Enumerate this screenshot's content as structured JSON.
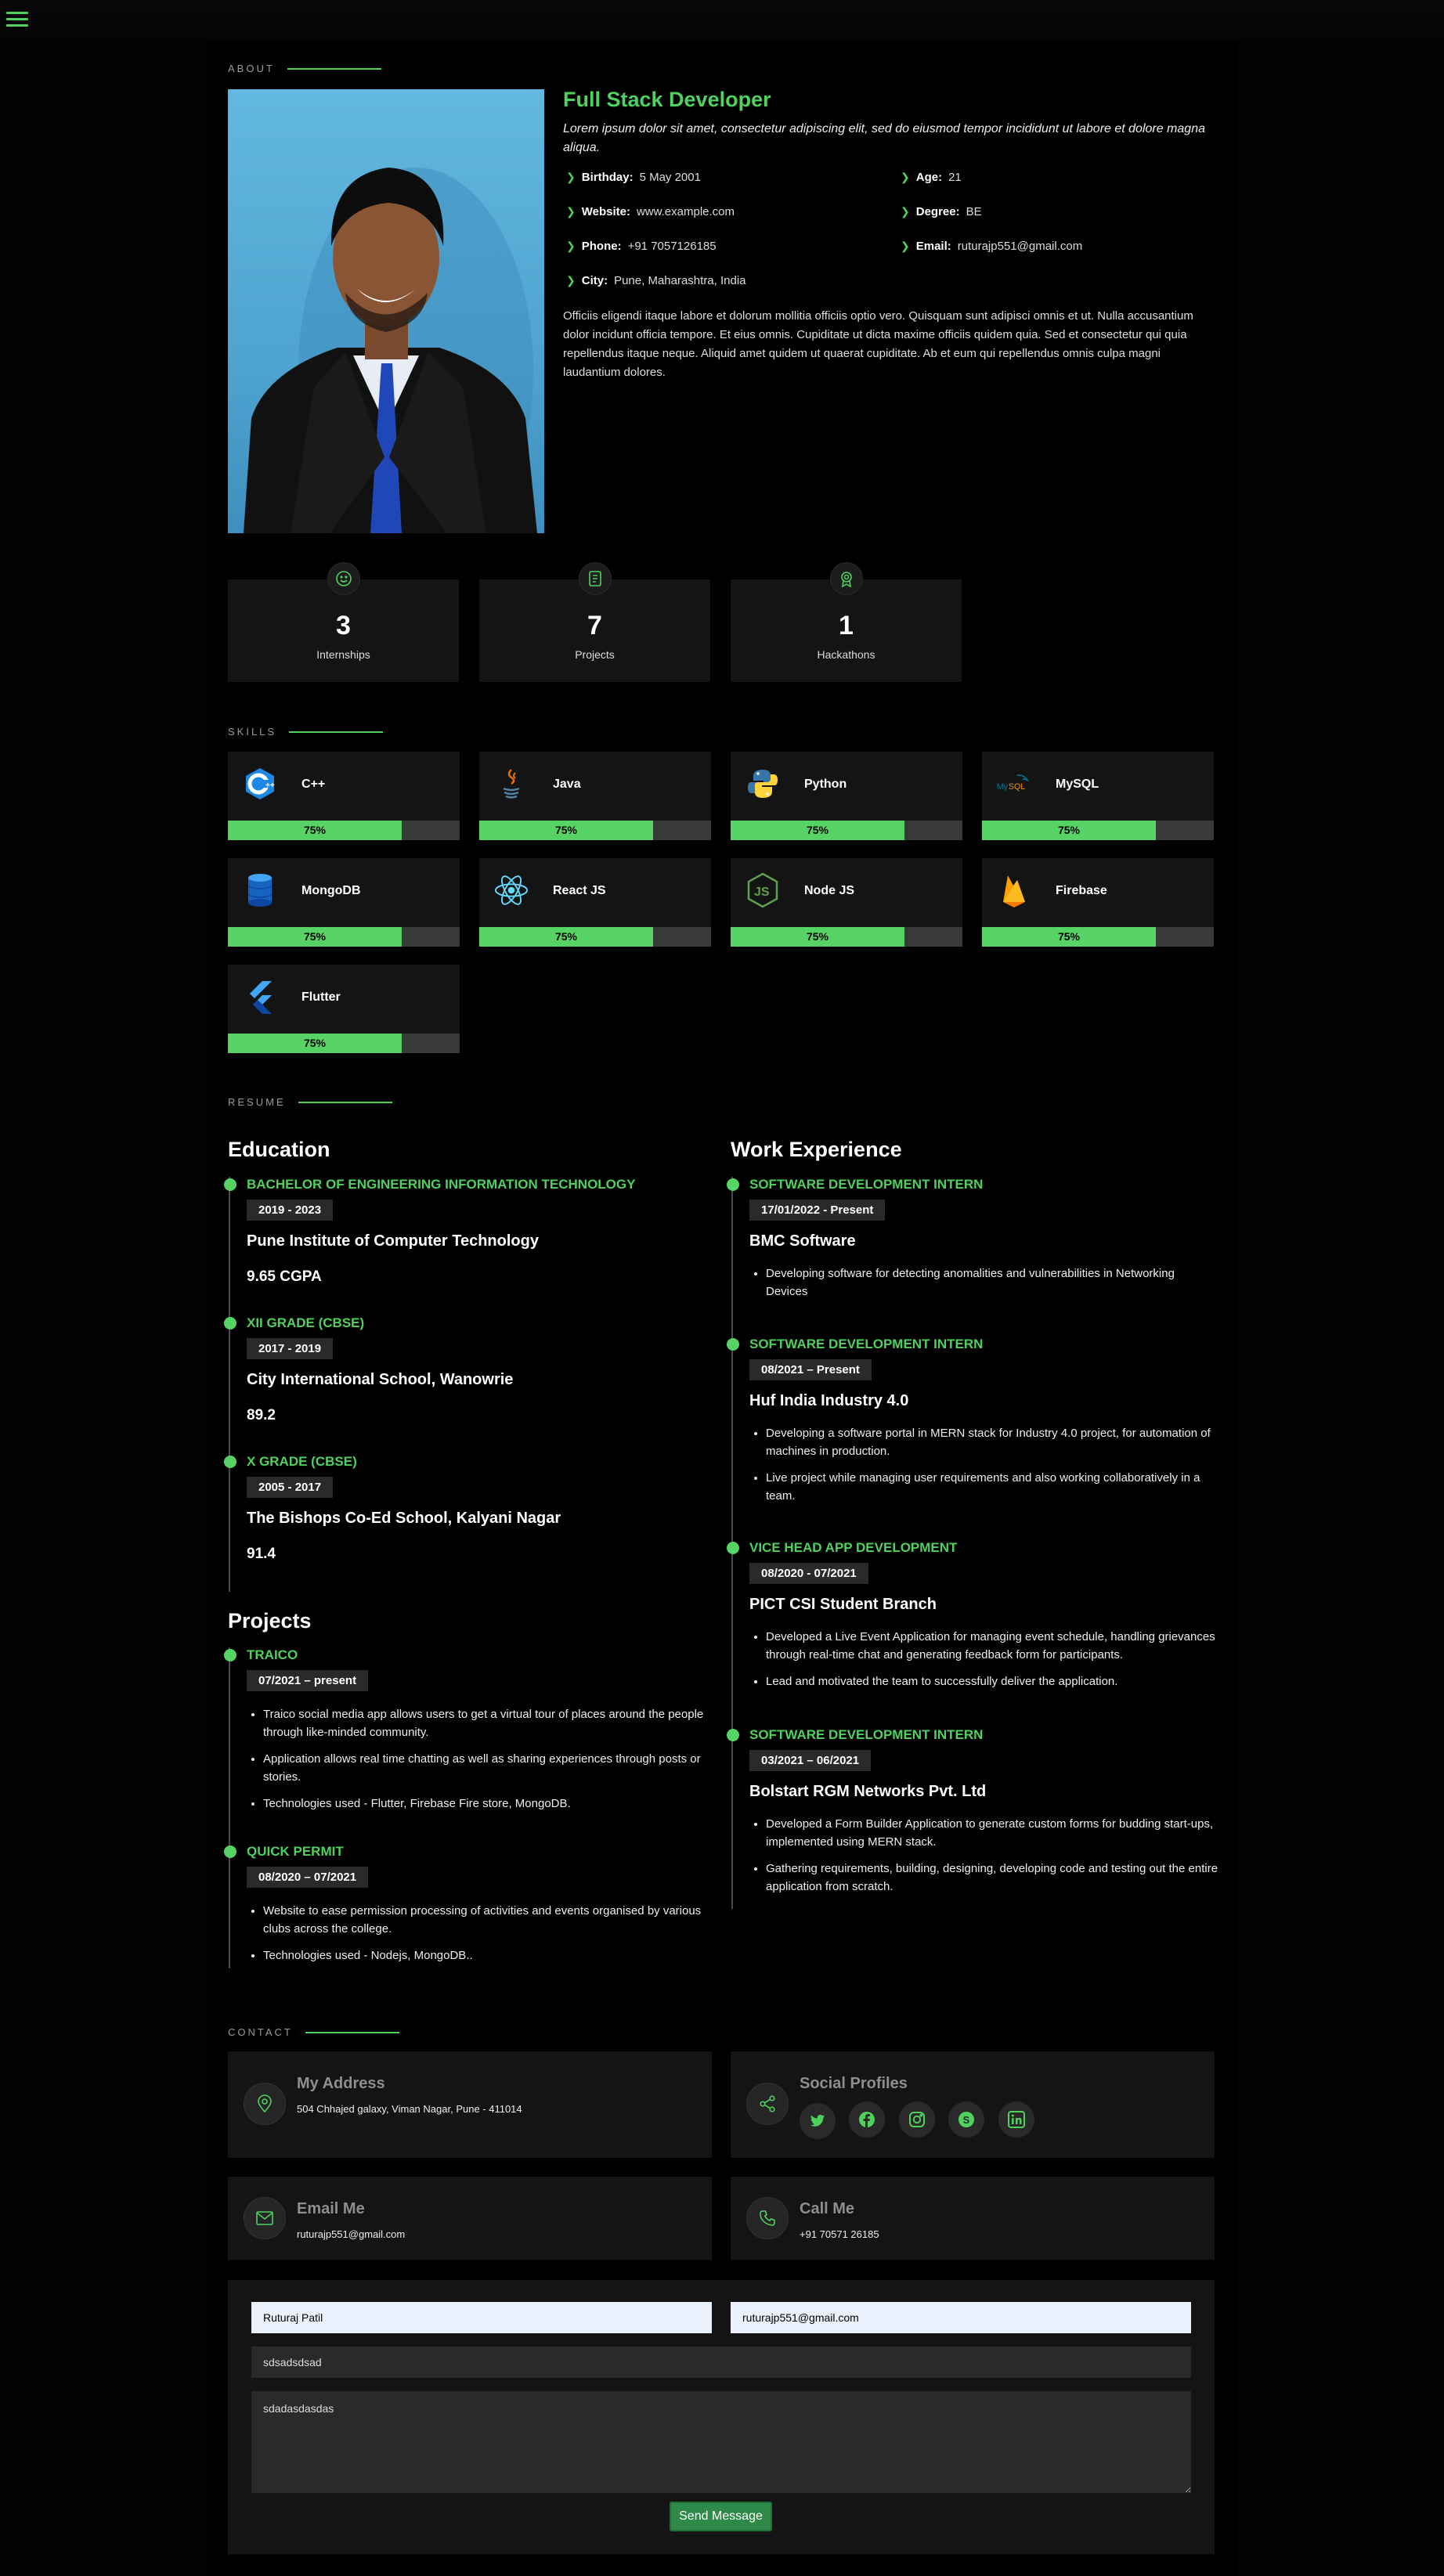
{
  "nav": {
    "menu_icon": "hamburger-icon"
  },
  "about": {
    "section_title": "About",
    "role": "Full Stack Developer",
    "lead": "Lorem ipsum dolor sit amet, consectetur adipiscing elit, sed do eiusmod tempor incididunt ut labore et dolore magna aliqua.",
    "facts": [
      {
        "label": "Birthday:",
        "value": "5 May 2001"
      },
      {
        "label": "Age:",
        "value": "21"
      },
      {
        "label": "Website:",
        "value": "www.example.com"
      },
      {
        "label": "Degree:",
        "value": "BE"
      },
      {
        "label": "Phone:",
        "value": "+91 7057126185"
      },
      {
        "label": "Email:",
        "value": "ruturajp551@gmail.com"
      },
      {
        "label": "City:",
        "value": "Pune, Maharashtra, India"
      }
    ],
    "description": "Officiis eligendi itaque labore et dolorum mollitia officiis optio vero. Quisquam sunt adipisci omnis et ut. Nulla accusantium dolor incidunt officia tempore. Et eius omnis. Cupiditate ut dicta maxime officiis quidem quia. Sed et consectetur qui quia repellendus itaque neque. Aliquid amet quidem ut quaerat cupiditate. Ab et eum qui repellendus omnis culpa magni laudantium dolores."
  },
  "counts": [
    {
      "icon": "smiley-icon",
      "value": "3",
      "label": "Internships"
    },
    {
      "icon": "document-icon",
      "value": "7",
      "label": "Projects"
    },
    {
      "icon": "award-icon",
      "value": "1",
      "label": "Hackathons"
    }
  ],
  "skills": {
    "section_title": "Skills",
    "items": [
      {
        "name": "C++",
        "level": "75%",
        "icon": "cpp-icon"
      },
      {
        "name": "Java",
        "level": "75%",
        "icon": "java-icon"
      },
      {
        "name": "Python",
        "level": "75%",
        "icon": "python-icon"
      },
      {
        "name": "MySQL",
        "level": "75%",
        "icon": "mysql-icon"
      },
      {
        "name": "MongoDB",
        "level": "75%",
        "icon": "database-icon"
      },
      {
        "name": "React JS",
        "level": "75%",
        "icon": "react-icon"
      },
      {
        "name": "Node JS",
        "level": "75%",
        "icon": "nodejs-icon"
      },
      {
        "name": "Firebase",
        "level": "75%",
        "icon": "firebase-icon"
      },
      {
        "name": "Flutter",
        "level": "75%",
        "icon": "flutter-icon"
      }
    ]
  },
  "resume": {
    "section_title": "Resume",
    "education_title": "Education",
    "education": [
      {
        "title": "Bachelor of Engineering Information Technology",
        "date": "2019 - 2023",
        "school": "Pune Institute of Computer Technology",
        "score": "9.65 CGPA"
      },
      {
        "title": "XII Grade (CBSE)",
        "date": "2017 - 2019",
        "school": "City International School, Wanowrie",
        "score": "89.2"
      },
      {
        "title": "X Grade (CBSE)",
        "date": "2005 - 2017",
        "school": "The Bishops Co-Ed School, Kalyani Nagar",
        "score": "91.4"
      }
    ],
    "projects_title": "Projects",
    "projects": [
      {
        "title": "Traico",
        "date": "07/2021 – present",
        "points": [
          "Traico social media app allows users to get a virtual tour of places around the people through like-minded community.",
          "Application allows real time chatting as well as sharing experiences through posts or stories.",
          "Technologies used - Flutter, Firebase Fire store, MongoDB."
        ]
      },
      {
        "title": "Quick Permit",
        "date": "08/2020 – 07/2021",
        "points": [
          "Website to ease permission processing of activities and events organised by various clubs across the college.",
          "Technologies used - Nodejs, MongoDB.."
        ]
      }
    ],
    "work_title": "Work Experience",
    "work": [
      {
        "title": "Software Development Intern",
        "date": "17/01/2022 - Present",
        "org": "BMC Software",
        "points": [
          "Developing software for detecting anomalities and vulnerabilities in Networking Devices"
        ]
      },
      {
        "title": "Software Development Intern",
        "date": "08/2021 – Present",
        "org": "Huf India Industry 4.0",
        "points": [
          "Developing a software portal in MERN stack for Industry 4.0 project, for automation of machines in production.",
          "Live project while managing user requirements and also working collaboratively in a team."
        ]
      },
      {
        "title": "Vice Head App Development",
        "date": "08/2020 - 07/2021",
        "org": "PICT CSI Student Branch",
        "points": [
          "Developed a Live Event Application for managing event schedule, handling grievances through real-time chat and generating feedback form for participants.",
          "Lead and motivated the team to successfully deliver the application."
        ]
      },
      {
        "title": "Software Development Intern",
        "date": "03/2021 – 06/2021",
        "org": "Bolstart RGM Networks Pvt. Ltd",
        "points": [
          "Developed a Form Builder Application to generate custom forms for budding start-ups, implemented using MERN stack.",
          "Gathering requirements, building, designing, developing code and testing out the entire application from scratch."
        ]
      }
    ]
  },
  "contact": {
    "section_title": "Contact",
    "address_title": "My Address",
    "address": "504 Chhajed galaxy, Viman Nagar, Pune - 411014",
    "social_title": "Social Profiles",
    "social_icons": [
      "twitter-icon",
      "facebook-icon",
      "instagram-icon",
      "skype-icon",
      "linkedin-icon"
    ],
    "email_title": "Email Me",
    "email": "ruturajp551@gmail.com",
    "call_title": "Call Me",
    "phone": "+91 70571 26185",
    "form": {
      "name": "Ruturaj Patil",
      "email": "ruturajp551@gmail.com",
      "subject": "sdsadsdsad",
      "message": "sdadasdasdas",
      "send_label": "Send Message"
    }
  },
  "colors": {
    "accent": "#4fd15e",
    "background": "#000000",
    "card": "#141414"
  }
}
